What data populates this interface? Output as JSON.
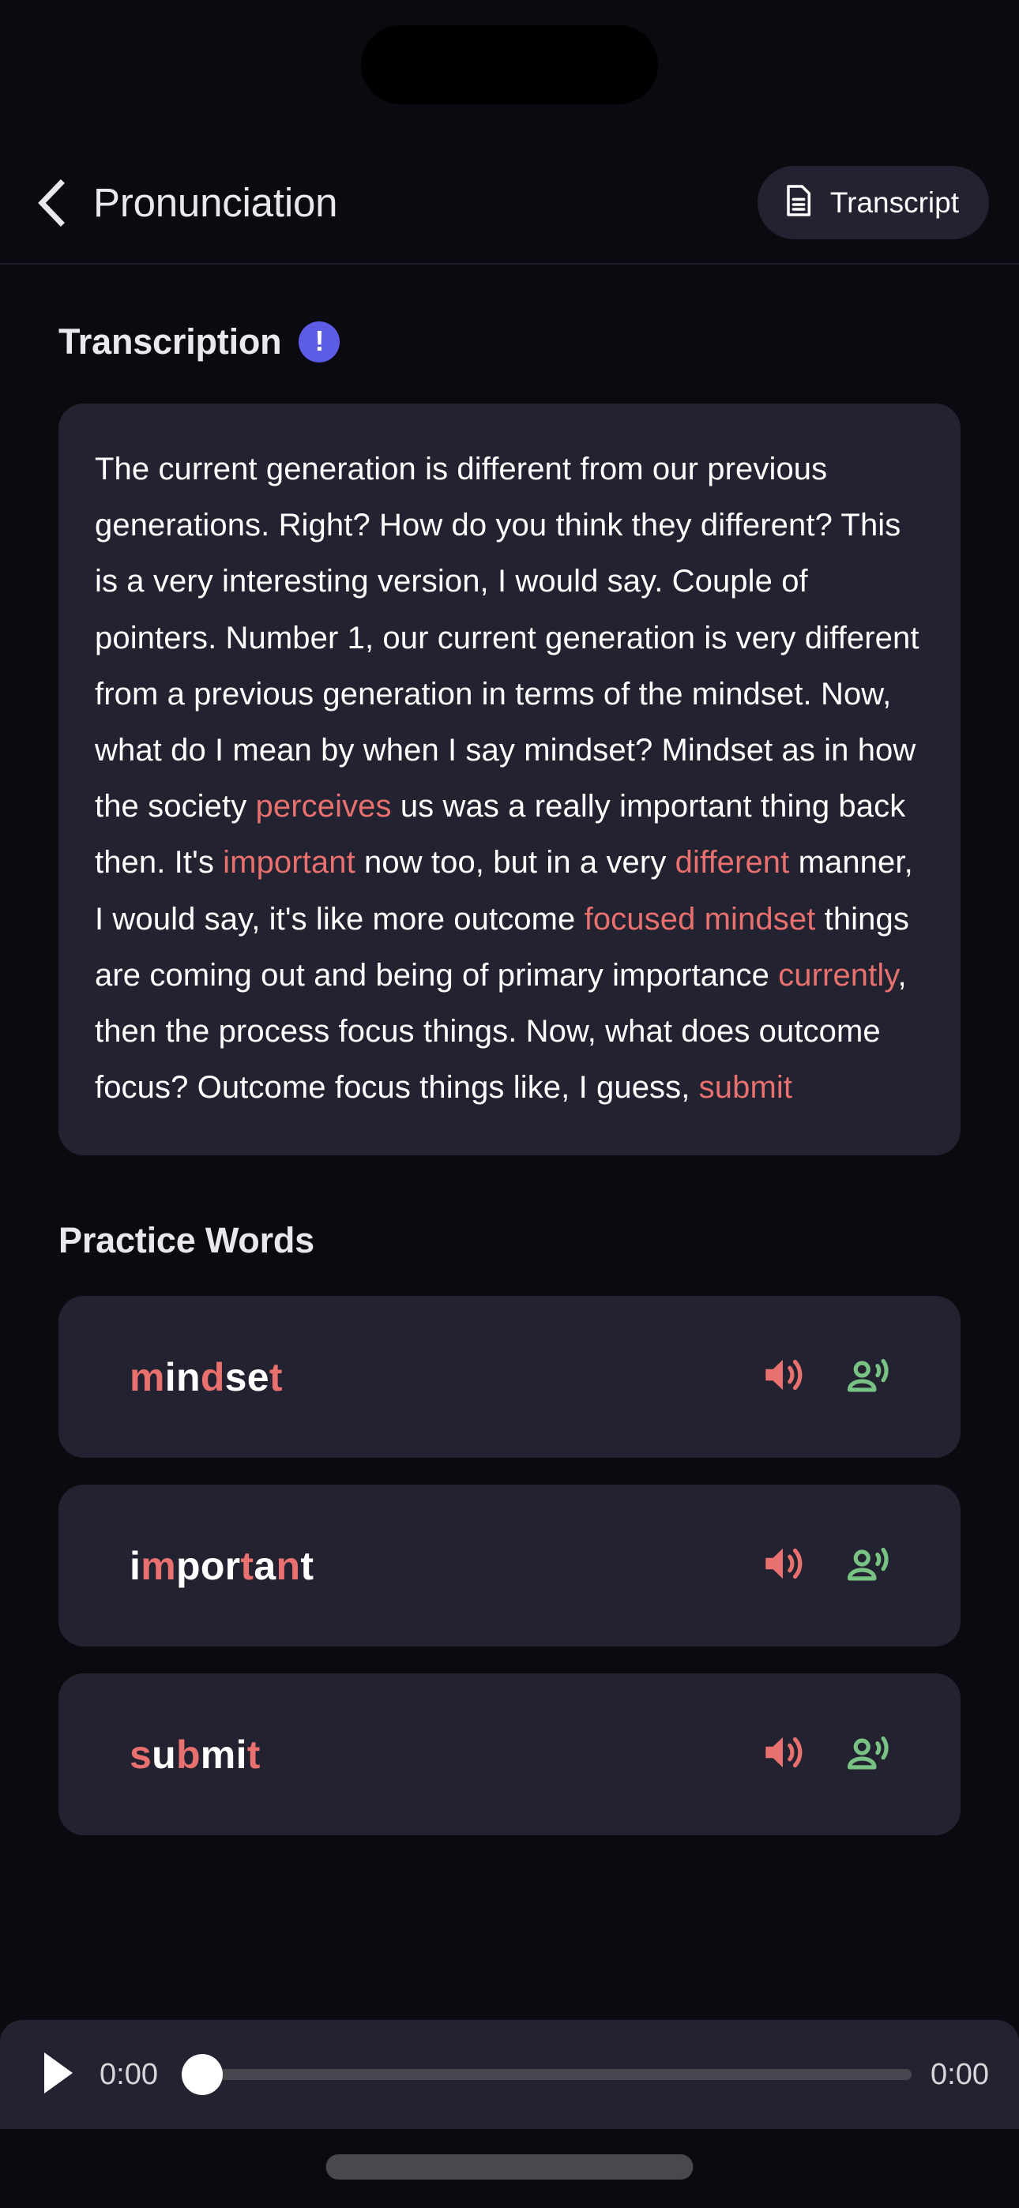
{
  "header": {
    "back_icon": "chevron-left-icon",
    "title": "Pronunciation",
    "transcript_button": {
      "icon": "document-icon",
      "label": "Transcript"
    }
  },
  "transcription": {
    "section_title": "Transcription",
    "info_badge": "!",
    "segments": [
      {
        "text": "The current generation is different from our previous generations. Right? How do you think they different? This is a very interesting version, I would say. Couple of pointers. Number 1, our current generation is very different from a previous generation in terms of the mindset. Now, what do I mean by when I say mindset? Mindset as in how the society ",
        "highlight": false
      },
      {
        "text": "perceives",
        "highlight": true
      },
      {
        "text": " us was a really important thing back then. It's ",
        "highlight": false
      },
      {
        "text": "important",
        "highlight": true
      },
      {
        "text": " now too, but in a very ",
        "highlight": false
      },
      {
        "text": "different",
        "highlight": true
      },
      {
        "text": " manner, I would say, it's like more outcome ",
        "highlight": false
      },
      {
        "text": "focused mindset",
        "highlight": true
      },
      {
        "text": " things are coming out and being of primary importance ",
        "highlight": false
      },
      {
        "text": "currently",
        "highlight": true
      },
      {
        "text": ", then the process focus things. Now, what does outcome focus? Outcome focus things like, I guess, ",
        "highlight": false
      },
      {
        "text": "submit",
        "highlight": true
      }
    ]
  },
  "practice": {
    "section_title": "Practice Words",
    "words": [
      {
        "word": "mindset",
        "chars": [
          {
            "c": "m",
            "red": true
          },
          {
            "c": "i",
            "red": false
          },
          {
            "c": "n",
            "red": false
          },
          {
            "c": "d",
            "red": true
          },
          {
            "c": "s",
            "red": false
          },
          {
            "c": "e",
            "red": false
          },
          {
            "c": "t",
            "red": true
          }
        ],
        "listen_icon": "speaker-icon",
        "record_icon": "record-voice-over-icon"
      },
      {
        "word": "important",
        "chars": [
          {
            "c": "i",
            "red": false
          },
          {
            "c": "m",
            "red": true
          },
          {
            "c": "p",
            "red": false
          },
          {
            "c": "o",
            "red": false
          },
          {
            "c": "r",
            "red": false
          },
          {
            "c": "t",
            "red": true
          },
          {
            "c": "a",
            "red": false
          },
          {
            "c": "n",
            "red": true
          },
          {
            "c": "t",
            "red": false
          }
        ],
        "listen_icon": "speaker-icon",
        "record_icon": "record-voice-over-icon"
      },
      {
        "word": "submit",
        "chars": [
          {
            "c": "s",
            "red": true
          },
          {
            "c": "u",
            "red": false
          },
          {
            "c": "b",
            "red": true
          },
          {
            "c": "m",
            "red": false
          },
          {
            "c": "i",
            "red": false
          },
          {
            "c": "t",
            "red": true
          }
        ],
        "listen_icon": "speaker-icon",
        "record_icon": "record-voice-over-icon"
      }
    ]
  },
  "player": {
    "play_icon": "play-icon",
    "current_time": "0:00",
    "total_time": "0:00",
    "progress_percent": 0
  },
  "colors": {
    "background": "#0b0a11",
    "card": "#232230",
    "highlight_red": "#e8706e",
    "accent_green": "#78c284",
    "badge_purple": "#5d5ce6",
    "text_primary": "#ffffff"
  }
}
